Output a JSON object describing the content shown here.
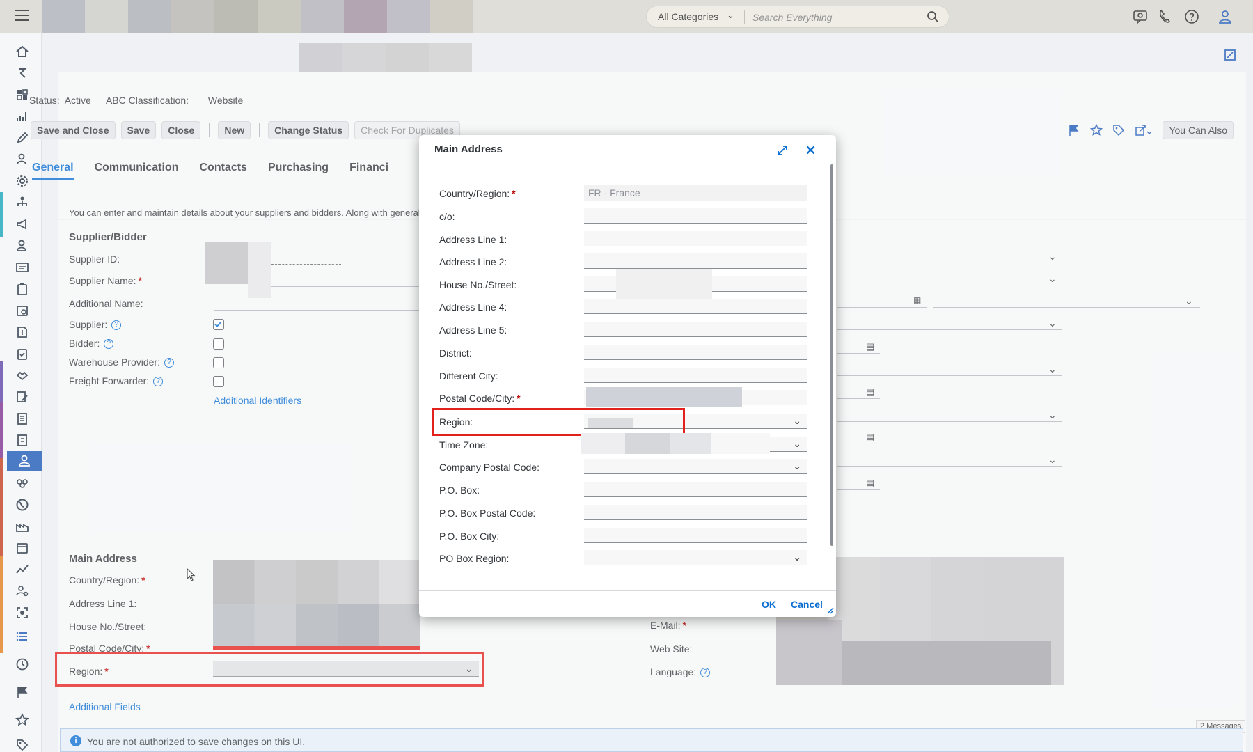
{
  "shell": {
    "search_category": "All Categories",
    "search_placeholder": "Search Everything"
  },
  "header": {
    "status_label": "Status:",
    "status_value": "Active",
    "abc_label": "ABC Classification:",
    "website_label": "Website"
  },
  "toolbar": {
    "save_close": "Save and Close",
    "save": "Save",
    "close": "Close",
    "new": "New",
    "change_status": "Change Status",
    "check_duplicates": "Check For Duplicates",
    "you_can_also": "You Can Also"
  },
  "tabs": [
    {
      "label": "General"
    },
    {
      "label": "Communication"
    },
    {
      "label": "Contacts"
    },
    {
      "label": "Purchasing"
    },
    {
      "label": "Financi"
    }
  ],
  "intro_text": "You can enter and maintain details about your suppliers and bidders. Along with general i",
  "supplier_section": {
    "title": "Supplier/Bidder",
    "supplier_id": "Supplier ID:",
    "supplier_name": "Supplier Name:",
    "additional_name": "Additional Name:",
    "supplier": "Supplier:",
    "bidder": "Bidder:",
    "warehouse_provider": "Warehouse Provider:",
    "freight_forwarder": "Freight Forwarder:",
    "additional_identifiers": "Additional Identifiers"
  },
  "main_address_section": {
    "title": "Main Address",
    "country_region": "Country/Region:",
    "address_line_1": "Address Line 1:",
    "house_no_street": "House No./Street:",
    "postal_code_city": "Postal Code/City:",
    "region": "Region:",
    "additional_fields": "Additional Fields",
    "email": "E-Mail:",
    "web_site": "Web Site:",
    "language": "Language:"
  },
  "message_bar": {
    "text": "You are not authorized to save changes on this UI.",
    "count": "2 Messages"
  },
  "dialog": {
    "title": "Main Address",
    "ok": "OK",
    "cancel": "Cancel",
    "fields": {
      "country_region": {
        "label": "Country/Region:",
        "value": "FR - France"
      },
      "co": {
        "label": "c/o:"
      },
      "address_line_1": {
        "label": "Address Line 1:"
      },
      "address_line_2": {
        "label": "Address Line 2:"
      },
      "house_no_street": {
        "label": "House No./Street:"
      },
      "address_line_4": {
        "label": "Address Line 4:"
      },
      "address_line_5": {
        "label": "Address Line 5:"
      },
      "district": {
        "label": "District:"
      },
      "different_city": {
        "label": "Different City:"
      },
      "postal_code_city": {
        "label": "Postal Code/City:"
      },
      "region": {
        "label": "Region:"
      },
      "time_zone": {
        "label": "Time Zone:"
      },
      "company_postal_code": {
        "label": "Company Postal Code:"
      },
      "po_box": {
        "label": "P.O. Box:"
      },
      "po_box_postal_code": {
        "label": "P.O. Box Postal Code:"
      },
      "po_box_city": {
        "label": "P.O. Box City:"
      },
      "po_box_region": {
        "label": "PO Box Region:"
      }
    }
  },
  "colors": {
    "accent": "#0a6ed1",
    "active_nav": "#1a56b5",
    "highlight_frame": "#e2211c",
    "required": "#bb0000"
  }
}
